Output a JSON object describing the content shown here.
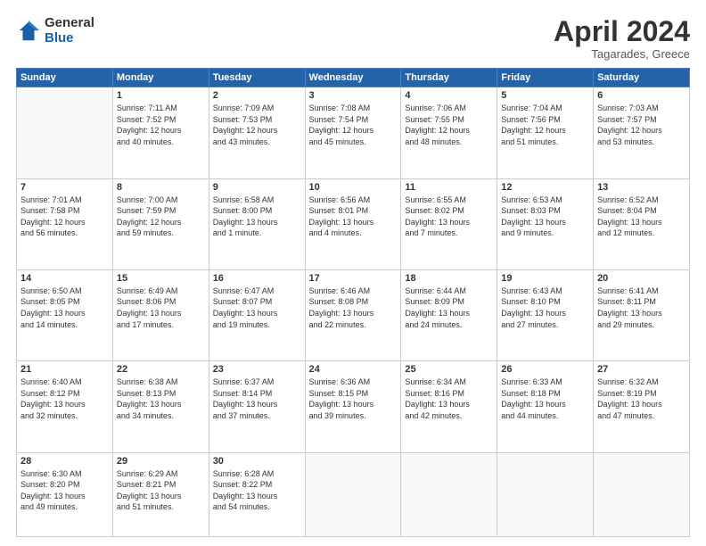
{
  "logo": {
    "general": "General",
    "blue": "Blue"
  },
  "title": "April 2024",
  "location": "Tagarades, Greece",
  "days_header": [
    "Sunday",
    "Monday",
    "Tuesday",
    "Wednesday",
    "Thursday",
    "Friday",
    "Saturday"
  ],
  "weeks": [
    [
      {
        "day": "",
        "info": ""
      },
      {
        "day": "1",
        "info": "Sunrise: 7:11 AM\nSunset: 7:52 PM\nDaylight: 12 hours\nand 40 minutes."
      },
      {
        "day": "2",
        "info": "Sunrise: 7:09 AM\nSunset: 7:53 PM\nDaylight: 12 hours\nand 43 minutes."
      },
      {
        "day": "3",
        "info": "Sunrise: 7:08 AM\nSunset: 7:54 PM\nDaylight: 12 hours\nand 45 minutes."
      },
      {
        "day": "4",
        "info": "Sunrise: 7:06 AM\nSunset: 7:55 PM\nDaylight: 12 hours\nand 48 minutes."
      },
      {
        "day": "5",
        "info": "Sunrise: 7:04 AM\nSunset: 7:56 PM\nDaylight: 12 hours\nand 51 minutes."
      },
      {
        "day": "6",
        "info": "Sunrise: 7:03 AM\nSunset: 7:57 PM\nDaylight: 12 hours\nand 53 minutes."
      }
    ],
    [
      {
        "day": "7",
        "info": "Sunrise: 7:01 AM\nSunset: 7:58 PM\nDaylight: 12 hours\nand 56 minutes."
      },
      {
        "day": "8",
        "info": "Sunrise: 7:00 AM\nSunset: 7:59 PM\nDaylight: 12 hours\nand 59 minutes."
      },
      {
        "day": "9",
        "info": "Sunrise: 6:58 AM\nSunset: 8:00 PM\nDaylight: 13 hours\nand 1 minute."
      },
      {
        "day": "10",
        "info": "Sunrise: 6:56 AM\nSunset: 8:01 PM\nDaylight: 13 hours\nand 4 minutes."
      },
      {
        "day": "11",
        "info": "Sunrise: 6:55 AM\nSunset: 8:02 PM\nDaylight: 13 hours\nand 7 minutes."
      },
      {
        "day": "12",
        "info": "Sunrise: 6:53 AM\nSunset: 8:03 PM\nDaylight: 13 hours\nand 9 minutes."
      },
      {
        "day": "13",
        "info": "Sunrise: 6:52 AM\nSunset: 8:04 PM\nDaylight: 13 hours\nand 12 minutes."
      }
    ],
    [
      {
        "day": "14",
        "info": "Sunrise: 6:50 AM\nSunset: 8:05 PM\nDaylight: 13 hours\nand 14 minutes."
      },
      {
        "day": "15",
        "info": "Sunrise: 6:49 AM\nSunset: 8:06 PM\nDaylight: 13 hours\nand 17 minutes."
      },
      {
        "day": "16",
        "info": "Sunrise: 6:47 AM\nSunset: 8:07 PM\nDaylight: 13 hours\nand 19 minutes."
      },
      {
        "day": "17",
        "info": "Sunrise: 6:46 AM\nSunset: 8:08 PM\nDaylight: 13 hours\nand 22 minutes."
      },
      {
        "day": "18",
        "info": "Sunrise: 6:44 AM\nSunset: 8:09 PM\nDaylight: 13 hours\nand 24 minutes."
      },
      {
        "day": "19",
        "info": "Sunrise: 6:43 AM\nSunset: 8:10 PM\nDaylight: 13 hours\nand 27 minutes."
      },
      {
        "day": "20",
        "info": "Sunrise: 6:41 AM\nSunset: 8:11 PM\nDaylight: 13 hours\nand 29 minutes."
      }
    ],
    [
      {
        "day": "21",
        "info": "Sunrise: 6:40 AM\nSunset: 8:12 PM\nDaylight: 13 hours\nand 32 minutes."
      },
      {
        "day": "22",
        "info": "Sunrise: 6:38 AM\nSunset: 8:13 PM\nDaylight: 13 hours\nand 34 minutes."
      },
      {
        "day": "23",
        "info": "Sunrise: 6:37 AM\nSunset: 8:14 PM\nDaylight: 13 hours\nand 37 minutes."
      },
      {
        "day": "24",
        "info": "Sunrise: 6:36 AM\nSunset: 8:15 PM\nDaylight: 13 hours\nand 39 minutes."
      },
      {
        "day": "25",
        "info": "Sunrise: 6:34 AM\nSunset: 8:16 PM\nDaylight: 13 hours\nand 42 minutes."
      },
      {
        "day": "26",
        "info": "Sunrise: 6:33 AM\nSunset: 8:18 PM\nDaylight: 13 hours\nand 44 minutes."
      },
      {
        "day": "27",
        "info": "Sunrise: 6:32 AM\nSunset: 8:19 PM\nDaylight: 13 hours\nand 47 minutes."
      }
    ],
    [
      {
        "day": "28",
        "info": "Sunrise: 6:30 AM\nSunset: 8:20 PM\nDaylight: 13 hours\nand 49 minutes."
      },
      {
        "day": "29",
        "info": "Sunrise: 6:29 AM\nSunset: 8:21 PM\nDaylight: 13 hours\nand 51 minutes."
      },
      {
        "day": "30",
        "info": "Sunrise: 6:28 AM\nSunset: 8:22 PM\nDaylight: 13 hours\nand 54 minutes."
      },
      {
        "day": "",
        "info": ""
      },
      {
        "day": "",
        "info": ""
      },
      {
        "day": "",
        "info": ""
      },
      {
        "day": "",
        "info": ""
      }
    ]
  ]
}
